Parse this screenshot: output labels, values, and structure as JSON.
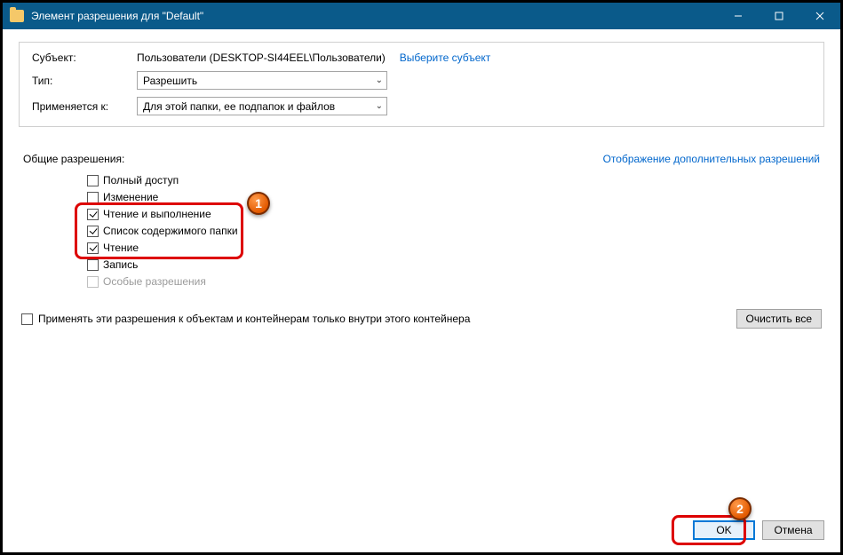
{
  "titlebar": {
    "title": "Элемент разрешения для \"Default\""
  },
  "header": {
    "subjectLabel": "Субъект:",
    "subjectValue": "Пользователи (DESKTOP-SI44EEL\\Пользователи)",
    "selectLink": "Выберите субъект",
    "typeLabel": "Тип:",
    "typeValue": "Разрешить",
    "appliesLabel": "Применяется к:",
    "appliesValue": "Для этой папки, ее подпапок и файлов"
  },
  "permissions": {
    "title": "Общие разрешения:",
    "advancedLink": "Отображение дополнительных разрешений",
    "items": [
      {
        "label": "Полный доступ",
        "checked": false,
        "disabled": false
      },
      {
        "label": "Изменение",
        "checked": false,
        "disabled": false
      },
      {
        "label": "Чтение и выполнение",
        "checked": true,
        "disabled": false
      },
      {
        "label": "Список содержимого папки",
        "checked": true,
        "disabled": false
      },
      {
        "label": "Чтение",
        "checked": true,
        "disabled": false
      },
      {
        "label": "Запись",
        "checked": false,
        "disabled": false
      },
      {
        "label": "Особые разрешения",
        "checked": false,
        "disabled": true
      }
    ]
  },
  "applyWithin": {
    "label": "Применять эти разрешения к объектам и контейнерам только внутри этого контейнера",
    "checked": false
  },
  "buttons": {
    "clear": "Очистить все",
    "ok": "OK",
    "cancel": "Отмена"
  },
  "annotations": {
    "badge1": "1",
    "badge2": "2"
  }
}
